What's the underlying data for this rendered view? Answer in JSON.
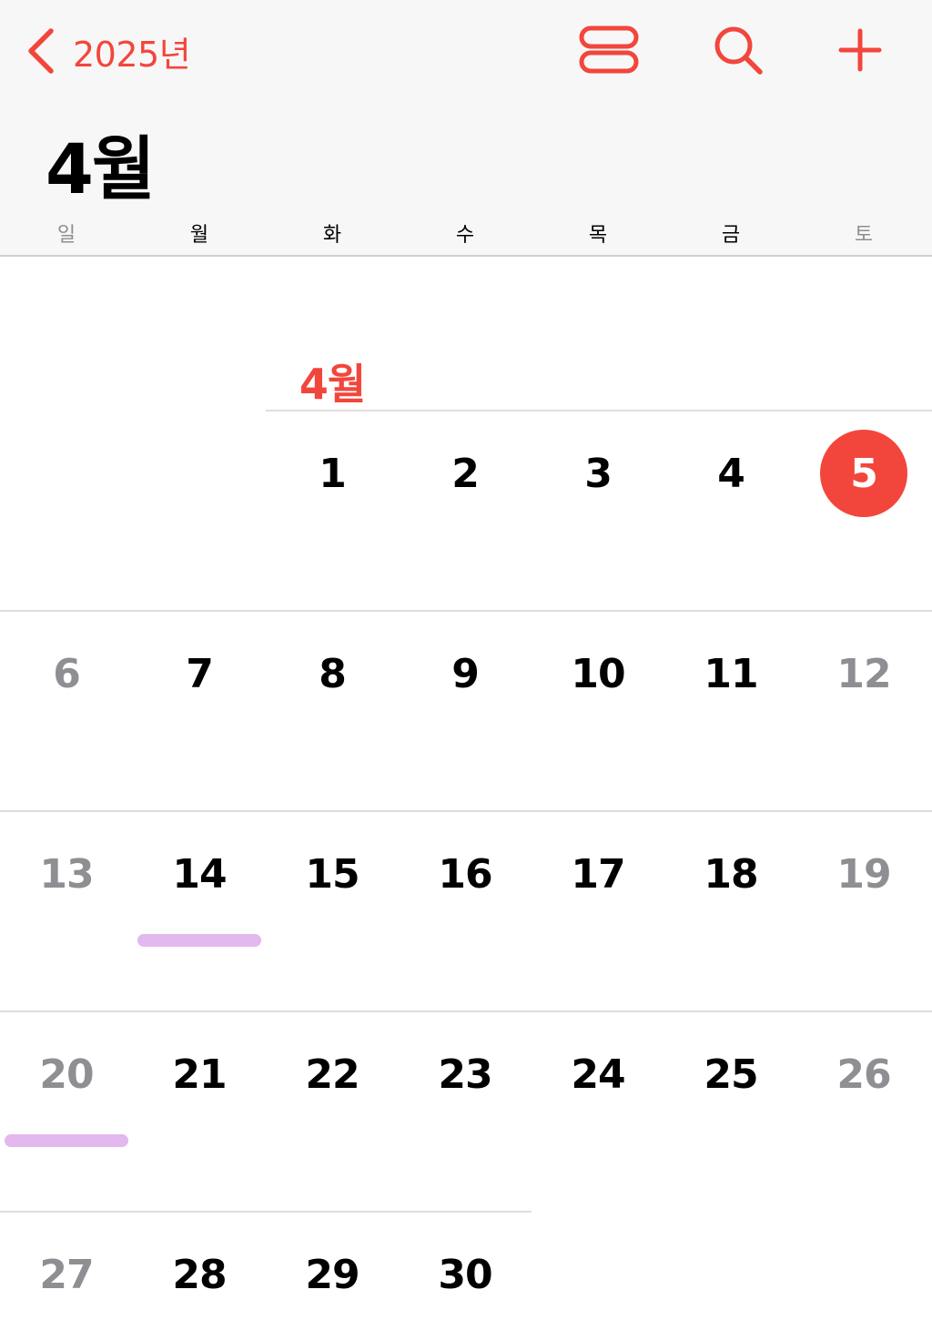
{
  "header": {
    "back_label": "2025년",
    "month_title": "4월",
    "weekdays": [
      "일",
      "월",
      "화",
      "수",
      "목",
      "금",
      "토"
    ]
  },
  "calendar": {
    "month_label": "4월",
    "today": "5",
    "rows": [
      [
        "",
        "",
        "1",
        "2",
        "3",
        "4",
        "5"
      ],
      [
        "6",
        "7",
        "8",
        "9",
        "10",
        "11",
        "12"
      ],
      [
        "13",
        "14",
        "15",
        "16",
        "17",
        "18",
        "19"
      ],
      [
        "20",
        "21",
        "22",
        "23",
        "24",
        "25",
        "26"
      ],
      [
        "27",
        "28",
        "29",
        "30",
        "",
        "",
        ""
      ]
    ]
  },
  "colors": {
    "accent": "#f2463c",
    "weekend_text": "#8e8e93",
    "event": "#e3b8ee"
  },
  "icons": {
    "back": "chevron-left-icon",
    "view_toggle": "stacked-view-icon",
    "search": "search-icon",
    "add": "plus-icon"
  }
}
